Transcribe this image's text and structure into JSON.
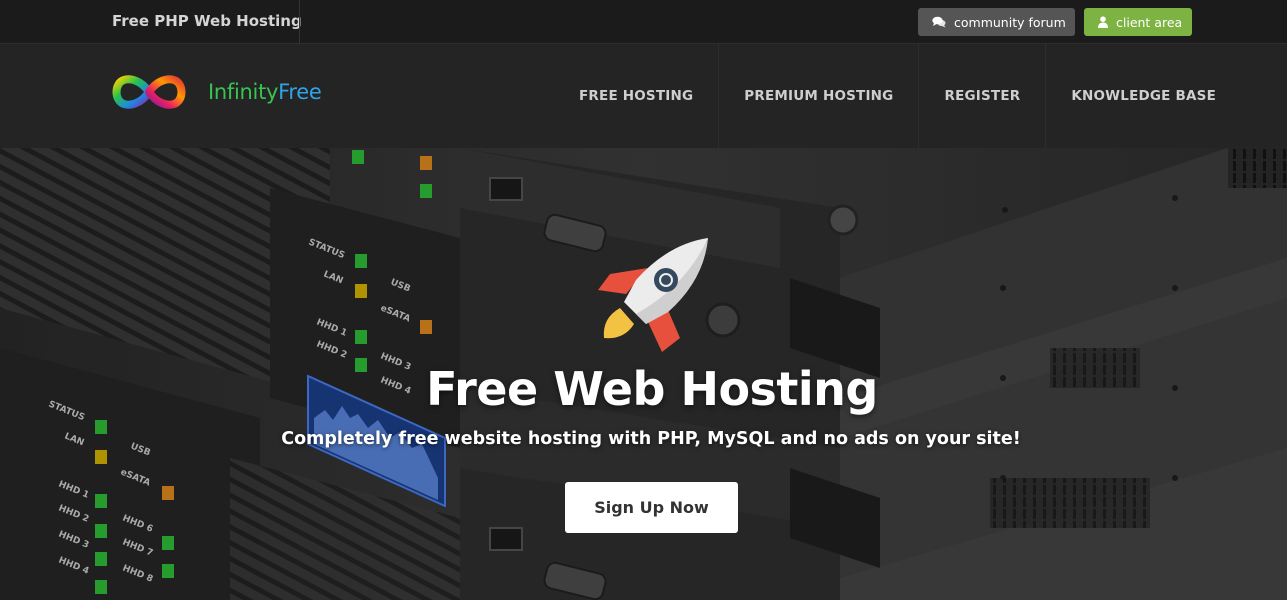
{
  "topbar": {
    "tagline": "Free PHP Web Hosting",
    "forum_button": {
      "label": "community forum",
      "icon": "chat-bubbles-icon"
    },
    "client_button": {
      "label": "client area",
      "icon": "user-icon"
    },
    "colors": {
      "forum_bg": "#555555",
      "client_bg": "#7cb342"
    }
  },
  "navbar": {
    "logo": {
      "word1": "Infinity",
      "word2": "Free",
      "icon": "infinity-logo-icon"
    },
    "items": [
      {
        "label": "FREE HOSTING"
      },
      {
        "label": "PREMIUM HOSTING"
      },
      {
        "label": "REGISTER"
      },
      {
        "label": "KNOWLEDGE BASE"
      }
    ]
  },
  "hero": {
    "icon": "rocket-icon",
    "title": "Free Web Hosting",
    "subtitle": "Completely free website hosting with PHP, MySQL and no ads on your site!",
    "cta_label": "Sign Up Now",
    "server_labels": [
      "STATUS",
      "LAN",
      "USB",
      "eSATA",
      "HHD 1",
      "HHD 2",
      "HHD 3",
      "HHD 4",
      "HHD 6",
      "HHD 7",
      "HHD 8"
    ]
  }
}
